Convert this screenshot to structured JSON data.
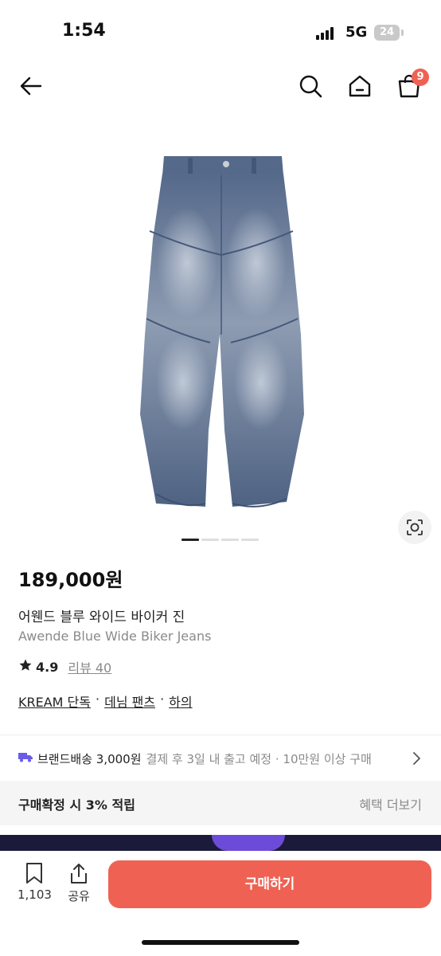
{
  "status_bar": {
    "time": "1:54",
    "network": "5G",
    "battery": "24"
  },
  "nav": {
    "back_icon": "back-arrow-icon",
    "search_icon": "search-icon",
    "home_icon": "home-icon",
    "cart_icon": "shopping-bag-icon",
    "cart_count": "9"
  },
  "gallery": {
    "current_index": 1,
    "total": 4,
    "lens_icon": "visual-search-icon"
  },
  "product": {
    "price": "189,000원",
    "name_ko": "어웬드 블루 와이드 바이커 진",
    "name_en": "Awende Blue Wide Biker Jeans",
    "rating": "4.9",
    "review_label": "리뷰 40",
    "categories": [
      "KREAM 단독",
      "데님 팬츠",
      "하의"
    ],
    "separator": "·"
  },
  "shipping": {
    "icon": "truck-icon",
    "title": "브랜드배송 3,000원",
    "detail": "결제 후 3일 내 출고 예정 · 10만원 이상 구매"
  },
  "points": {
    "label": "구매확정 시 3% 적립",
    "more": "혜택 더보기"
  },
  "bottom_bar": {
    "bookmark_count": "1,103",
    "share_label": "공유",
    "buy_label": "구매하기"
  },
  "colors": {
    "accent": "#ef6253",
    "denim": "#5d6f8b",
    "muted_text": "#8a8a8a"
  }
}
